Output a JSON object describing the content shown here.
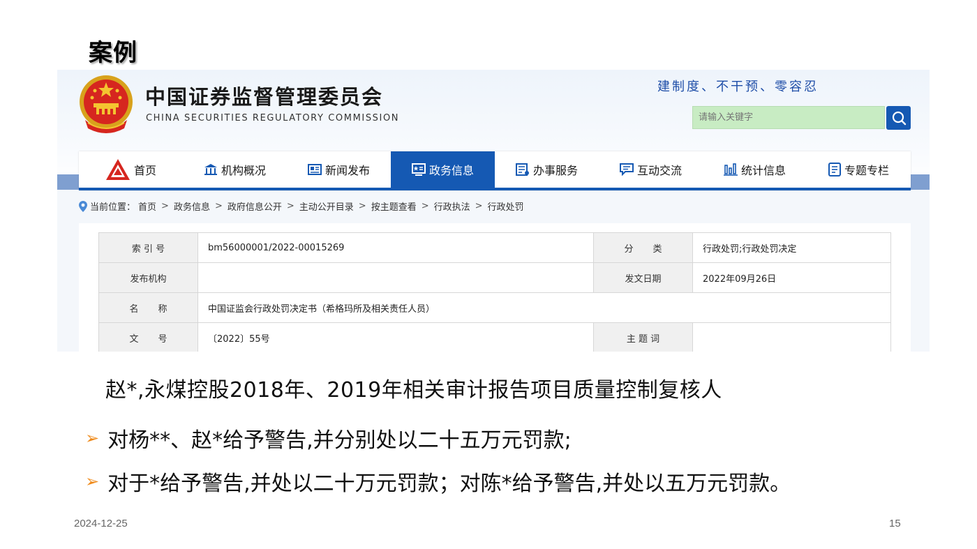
{
  "slide": {
    "title": "案例",
    "date": "2024-12-25",
    "page_number": "15"
  },
  "site": {
    "org_name_cn": "中国证券监督管理委员会",
    "org_name_en": "CHINA SECURITIES REGULATORY COMMISSION",
    "slogan": "建制度、不干预、零容忍",
    "search_placeholder": "请输入关键字",
    "nav": [
      {
        "label": "首页",
        "icon": "logo-icon",
        "active": false
      },
      {
        "label": "机构概况",
        "icon": "building-icon",
        "active": false
      },
      {
        "label": "新闻发布",
        "icon": "newspaper-icon",
        "active": false
      },
      {
        "label": "政务信息",
        "icon": "gov-info-icon",
        "active": true
      },
      {
        "label": "办事服务",
        "icon": "service-icon",
        "active": false
      },
      {
        "label": "互动交流",
        "icon": "chat-icon",
        "active": false
      },
      {
        "label": "统计信息",
        "icon": "bar-chart-icon",
        "active": false
      },
      {
        "label": "专题专栏",
        "icon": "document-icon",
        "active": false
      }
    ],
    "breadcrumb": {
      "prefix": "当前位置：",
      "items": [
        "首页",
        "政务信息",
        "政府信息公开",
        "主动公开目录",
        "按主题查看",
        "行政执法",
        "行政处罚"
      ]
    },
    "meta_table": {
      "index_label": "索 引 号",
      "index_value": "bm56000001/2022-00015269",
      "category_label": "分类",
      "category_value": "行政处罚;行政处罚决定",
      "issuer_label": "发布机构",
      "issuer_value": "",
      "date_label": "发文日期",
      "date_value": "2022年09月26日",
      "name_label": "名称",
      "name_value": "中国证监会行政处罚决定书（希格玛所及相关责任人员）",
      "doc_no_label": "文号",
      "doc_no_value": "〔2022〕55号",
      "keywords_label": "主 题 词",
      "keywords_value": ""
    }
  },
  "content": {
    "main_line": "赵*,永煤控股2018年、2019年相关审计报告项目质量控制复核人",
    "bullets": [
      "对杨**、赵*给予警告,并分别处以二十五万元罚款;",
      "对于*给予警告,并处以二十万元罚款；对陈*给予警告,并处以五万元罚款。"
    ]
  },
  "colors": {
    "nav_active": "#1559b3",
    "slogan": "#1f4ea8",
    "search_bg": "#c8ecc3",
    "bullet_arrow": "#ef8a1a"
  }
}
